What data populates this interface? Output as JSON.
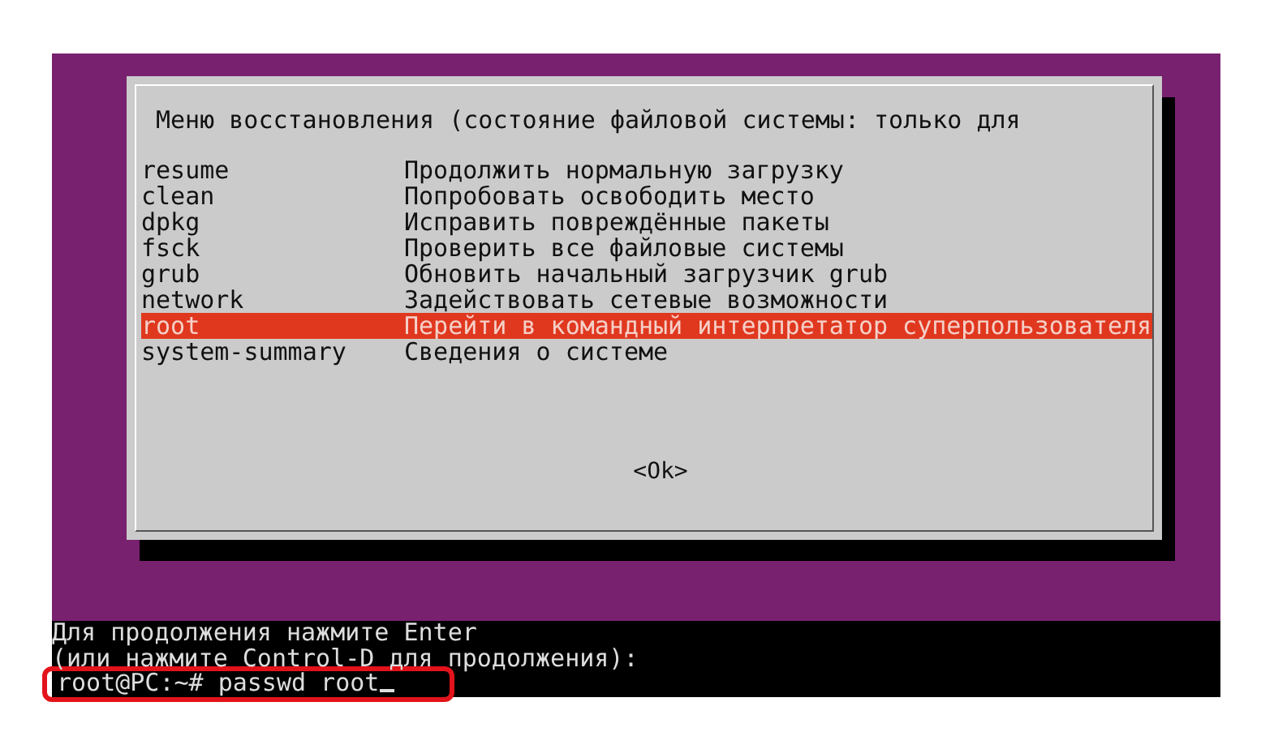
{
  "dialog": {
    "title": "Меню восстановления (состояние файловой системы: только для",
    "items": [
      {
        "command": "resume",
        "description": "Продолжить нормальную загрузку",
        "selected": false
      },
      {
        "command": "clean",
        "description": "Попробовать освободить место",
        "selected": false
      },
      {
        "command": "dpkg",
        "description": "Исправить повреждённые пакеты",
        "selected": false
      },
      {
        "command": "fsck",
        "description": "Проверить все файловые системы",
        "selected": false
      },
      {
        "command": "grub",
        "description": "Обновить начальный загрузчик grub",
        "selected": false
      },
      {
        "command": "network",
        "description": "Задействовать сетевые возможности",
        "selected": false
      },
      {
        "command": "root",
        "description": "Перейти в командный интерпретатор суперпользователя",
        "selected": true
      },
      {
        "command": "system-summary",
        "description": "Сведения о системе",
        "selected": false
      }
    ],
    "ok_button": "<Ok>"
  },
  "console": {
    "lines": [
      "Для продолжения нажмите Enter",
      "(или нажмите Control-D для продолжения):"
    ],
    "prompt": {
      "text": "root@PC:~# passwd root",
      "highlighted": true
    }
  }
}
